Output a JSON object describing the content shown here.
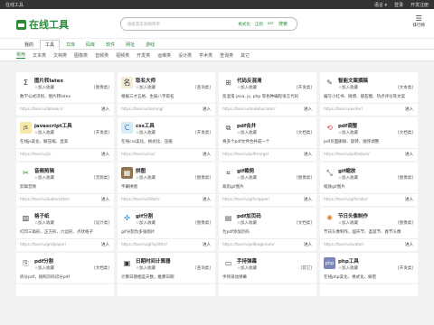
{
  "topbar": {
    "left": "在线工具",
    "lang": "语言 ▾",
    "login": "登录",
    "dev": "开发注册"
  },
  "header": {
    "logo": "在线工具",
    "search_placeholder": "搜索其实就很简单",
    "opt1": "格式化",
    "opt2": "正则",
    "opt3": "ocr",
    "search_btn": "搜索",
    "rank": "排行榜"
  },
  "nav1": [
    "我的",
    "工具",
    "文库",
    "码库",
    "软件",
    "网址",
    "游戏"
  ],
  "nav2": [
    "常用",
    "文本类",
    "文档类",
    "图像类",
    "音频类",
    "视频类",
    "开发类",
    "运维类",
    "设计类",
    "学术类",
    "查询类",
    "其它"
  ],
  "cards": [
    {
      "title": "图片转latex",
      "fav": "☆加入收藏",
      "cat": "[图像类]",
      "desc": "数学公式识别，图片转latex",
      "url": "https://tool.lu/latexocr/",
      "enter": "进入",
      "icon": "Σ",
      "bg": "#ffffff",
      "fg": "#333333"
    },
    {
      "title": "取名大师",
      "fav": "☆加入收藏",
      "cat": "[查询类]",
      "desc": "根据三才五格、生辰八字取名",
      "url": "https://tool.lu/naming/",
      "enter": "进入",
      "icon": "名",
      "bg": "#f5ecd8",
      "fg": "#333333"
    },
    {
      "title": "代码反混淆",
      "fav": "☆加入收藏",
      "cat": "[开发类]",
      "desc": "反混淆 java, js, php 等各种编程语言代码",
      "url": "https://tool.lu/deobfuscator/",
      "enter": "进入",
      "icon": "⊞",
      "bg": "#ffffff",
      "fg": "#555555"
    },
    {
      "title": "智能文案撰稿",
      "fav": "☆加入收藏",
      "cat": "[文本类]",
      "desc": "编写小红书、微博、朋友圈、热点评论等文案",
      "url": "https://tool.lu/writer/",
      "enter": "进入",
      "icon": "✎",
      "bg": "#ffffff",
      "fg": "#555555"
    },
    {
      "title": "javascript工具",
      "fav": "☆加入收藏",
      "cat": "[开发类]",
      "desc": "在线js美化、解压缩、混淆",
      "url": "https://tool.lu/js/",
      "enter": "进入",
      "icon": "JS",
      "bg": "#f7e9a8",
      "fg": "#333333"
    },
    {
      "title": "css工具",
      "fav": "☆加入收藏",
      "cat": "[开发类]",
      "desc": "在线css美化、格式化、压缩",
      "url": "https://tool.lu/css/",
      "enter": "进入",
      "icon": "C",
      "bg": "#d8ecf7",
      "fg": "#2a7ab8"
    },
    {
      "title": "pdf合并",
      "fav": "☆加入收藏",
      "cat": "[文档类]",
      "desc": "将多个pdf文件合并成一个",
      "url": "https://tool.lu/pdfmerge/",
      "enter": "进入",
      "icon": "⧉",
      "bg": "#ffffff",
      "fg": "#555555"
    },
    {
      "title": "pdf调整",
      "fav": "☆加入收藏",
      "cat": "[文档类]",
      "desc": "pdf页面删除、旋转、顺序调整",
      "url": "https://tool.lu/pdfadjust/",
      "enter": "进入",
      "icon": "⟲",
      "bg": "#ffffff",
      "fg": "#d33333"
    },
    {
      "title": "音频剪辑",
      "fav": "☆加入收藏",
      "cat": "[音频类]",
      "desc": "剪辑音频",
      "url": "https://tool.lu/audiocutter/",
      "enter": "进入",
      "icon": "✂",
      "bg": "#ffffff",
      "fg": "#2a8c3a"
    },
    {
      "title": "拼图",
      "fav": "☆加入收藏",
      "cat": "[图像类]",
      "desc": "字幕拼图",
      "url": "https://tool.lu/stitch/",
      "enter": "进入",
      "icon": "▦",
      "bg": "#8e7450",
      "fg": "#ffffff"
    },
    {
      "title": "gif裁剪",
      "fav": "☆加入收藏",
      "cat": "[图像类]",
      "desc": "裁剪gif图片",
      "url": "https://tool.lu/gifcropper/",
      "enter": "进入",
      "icon": "⌗",
      "bg": "#ffffff",
      "fg": "#333333"
    },
    {
      "title": "gif缩放",
      "fav": "☆加入收藏",
      "cat": "[图像类]",
      "desc": "缩放gif图片",
      "url": "https://tool.lu/gifscaler/",
      "enter": "进入",
      "icon": "⤡",
      "bg": "#ffffff",
      "fg": "#333333"
    },
    {
      "title": "格子纸",
      "fav": "☆加入收藏",
      "cat": "[设计类]",
      "desc": "打印三角形、正方形、六边形、点状格子",
      "url": "https://tool.lu/gridpaper/",
      "enter": "进入",
      "icon": "▥",
      "bg": "#ffffff",
      "fg": "#333333"
    },
    {
      "title": "gif分割",
      "fav": "☆加入收藏",
      "cat": "[图像类]",
      "desc": "gif分割为多张图片",
      "url": "https://tool.lu/gifsplitter/",
      "enter": "进入",
      "icon": "✣",
      "bg": "#ffffff",
      "fg": "#2a7ab8"
    },
    {
      "title": "pdf加页码",
      "fav": "☆加入收藏",
      "cat": "[文档类]",
      "desc": "为pdf添加页码",
      "url": "https://tool.lu/pdfpagenum/",
      "enter": "进入",
      "icon": "▤",
      "bg": "#ffffff",
      "fg": "#555555"
    },
    {
      "title": "节日头像制作",
      "fav": "☆加入收藏",
      "cat": "[图像类]",
      "desc": "节日头像制作，国庆节、圣诞节、春节头像",
      "url": "https://tool.lu/avatar/",
      "enter": "进入",
      "icon": "✺",
      "bg": "#ffffff",
      "fg": "#d9822b"
    },
    {
      "title": "pdf分割",
      "fav": "☆加入收藏",
      "cat": "[文档类]",
      "desc": "拆分pdf，按照页码切分pdf",
      "url": "",
      "enter": "",
      "icon": "⎘",
      "bg": "#ffffff",
      "fg": "#555555"
    },
    {
      "title": "日期时间计算器",
      "fav": "☆加入收藏",
      "cat": "[查询类]",
      "desc": "计算日期相差天数，推算日期",
      "url": "",
      "enter": "",
      "icon": "▣",
      "bg": "#ffffff",
      "fg": "#333333"
    },
    {
      "title": "手持弹幕",
      "fav": "☆加入收藏",
      "cat": "[其它]",
      "desc": "手持滚动弹幕",
      "url": "",
      "enter": "",
      "icon": "▭",
      "bg": "#ffffff",
      "fg": "#333333"
    },
    {
      "title": "php工具",
      "fav": "☆加入收藏",
      "cat": "[开发类]",
      "desc": "在线php美化、格式化、解密",
      "url": "",
      "enter": "",
      "icon": "php",
      "bg": "#7a86b8",
      "fg": "#ffffff"
    }
  ]
}
